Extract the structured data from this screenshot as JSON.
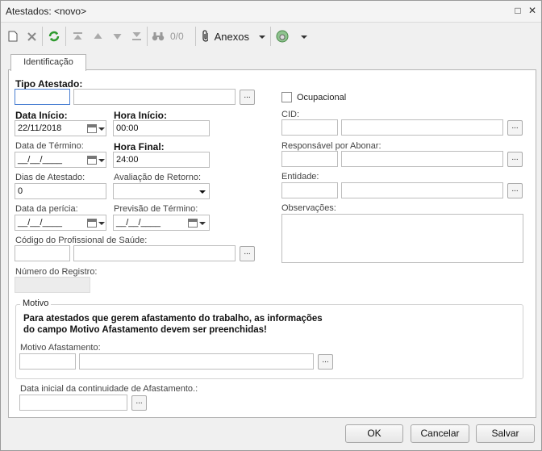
{
  "window": {
    "title": "Atestados: <novo>",
    "minimize_icon": "□",
    "close_icon": "✕"
  },
  "toolbar": {
    "anexos_label": "Anexos",
    "counter": "0/0"
  },
  "tab": {
    "label": "Identificação"
  },
  "form": {
    "tipo_atestado": {
      "label": "Tipo Atestado:",
      "code": "",
      "desc": ""
    },
    "ocupacional": {
      "label": "Ocupacional",
      "checked": false
    },
    "data_inicio": {
      "label": "Data Início:",
      "value": "22/11/2018"
    },
    "hora_inicio": {
      "label": "Hora Início:",
      "value": "00:00"
    },
    "cid": {
      "label": "CID:",
      "code": "",
      "desc": ""
    },
    "data_termino": {
      "label": "Data de Término:",
      "value": "__/__/____"
    },
    "hora_final": {
      "label": "Hora Final:",
      "value": "24:00"
    },
    "responsavel": {
      "label": "Responsável por Abonar:",
      "code": "",
      "desc": ""
    },
    "dias_atestado": {
      "label": "Dias de Atestado:",
      "value": "0"
    },
    "avaliacao_retorno": {
      "label": "Avaliação de Retorno:",
      "value": ""
    },
    "entidade": {
      "label": "Entidade:",
      "code": "",
      "desc": ""
    },
    "data_pericia": {
      "label": "Data da perícia:",
      "value": "__/__/____"
    },
    "previsao_termino": {
      "label": "Previsão de Término:",
      "value": "__/__/____"
    },
    "observacoes": {
      "label": "Observações:",
      "value": ""
    },
    "codigo_profissional": {
      "label": "Código do Profissional de Saúde:",
      "code": "",
      "desc": ""
    },
    "numero_registro": {
      "label": "Número do Registro:",
      "value": ""
    },
    "motivo": {
      "legend": "Motivo",
      "message_line1": "Para atestados que gerem afastamento do trabalho, as informações",
      "message_line2": "do campo Motivo Afastamento devem ser preenchidas!",
      "afastamento_label": "Motivo Afastamento:",
      "code": "",
      "desc": ""
    },
    "data_continuidade": {
      "label": "Data inicial da continuidade de Afastamento.:",
      "value": ""
    },
    "lookup_button": "..."
  },
  "footer": {
    "ok": "OK",
    "cancel": "Cancelar",
    "save": "Salvar"
  }
}
